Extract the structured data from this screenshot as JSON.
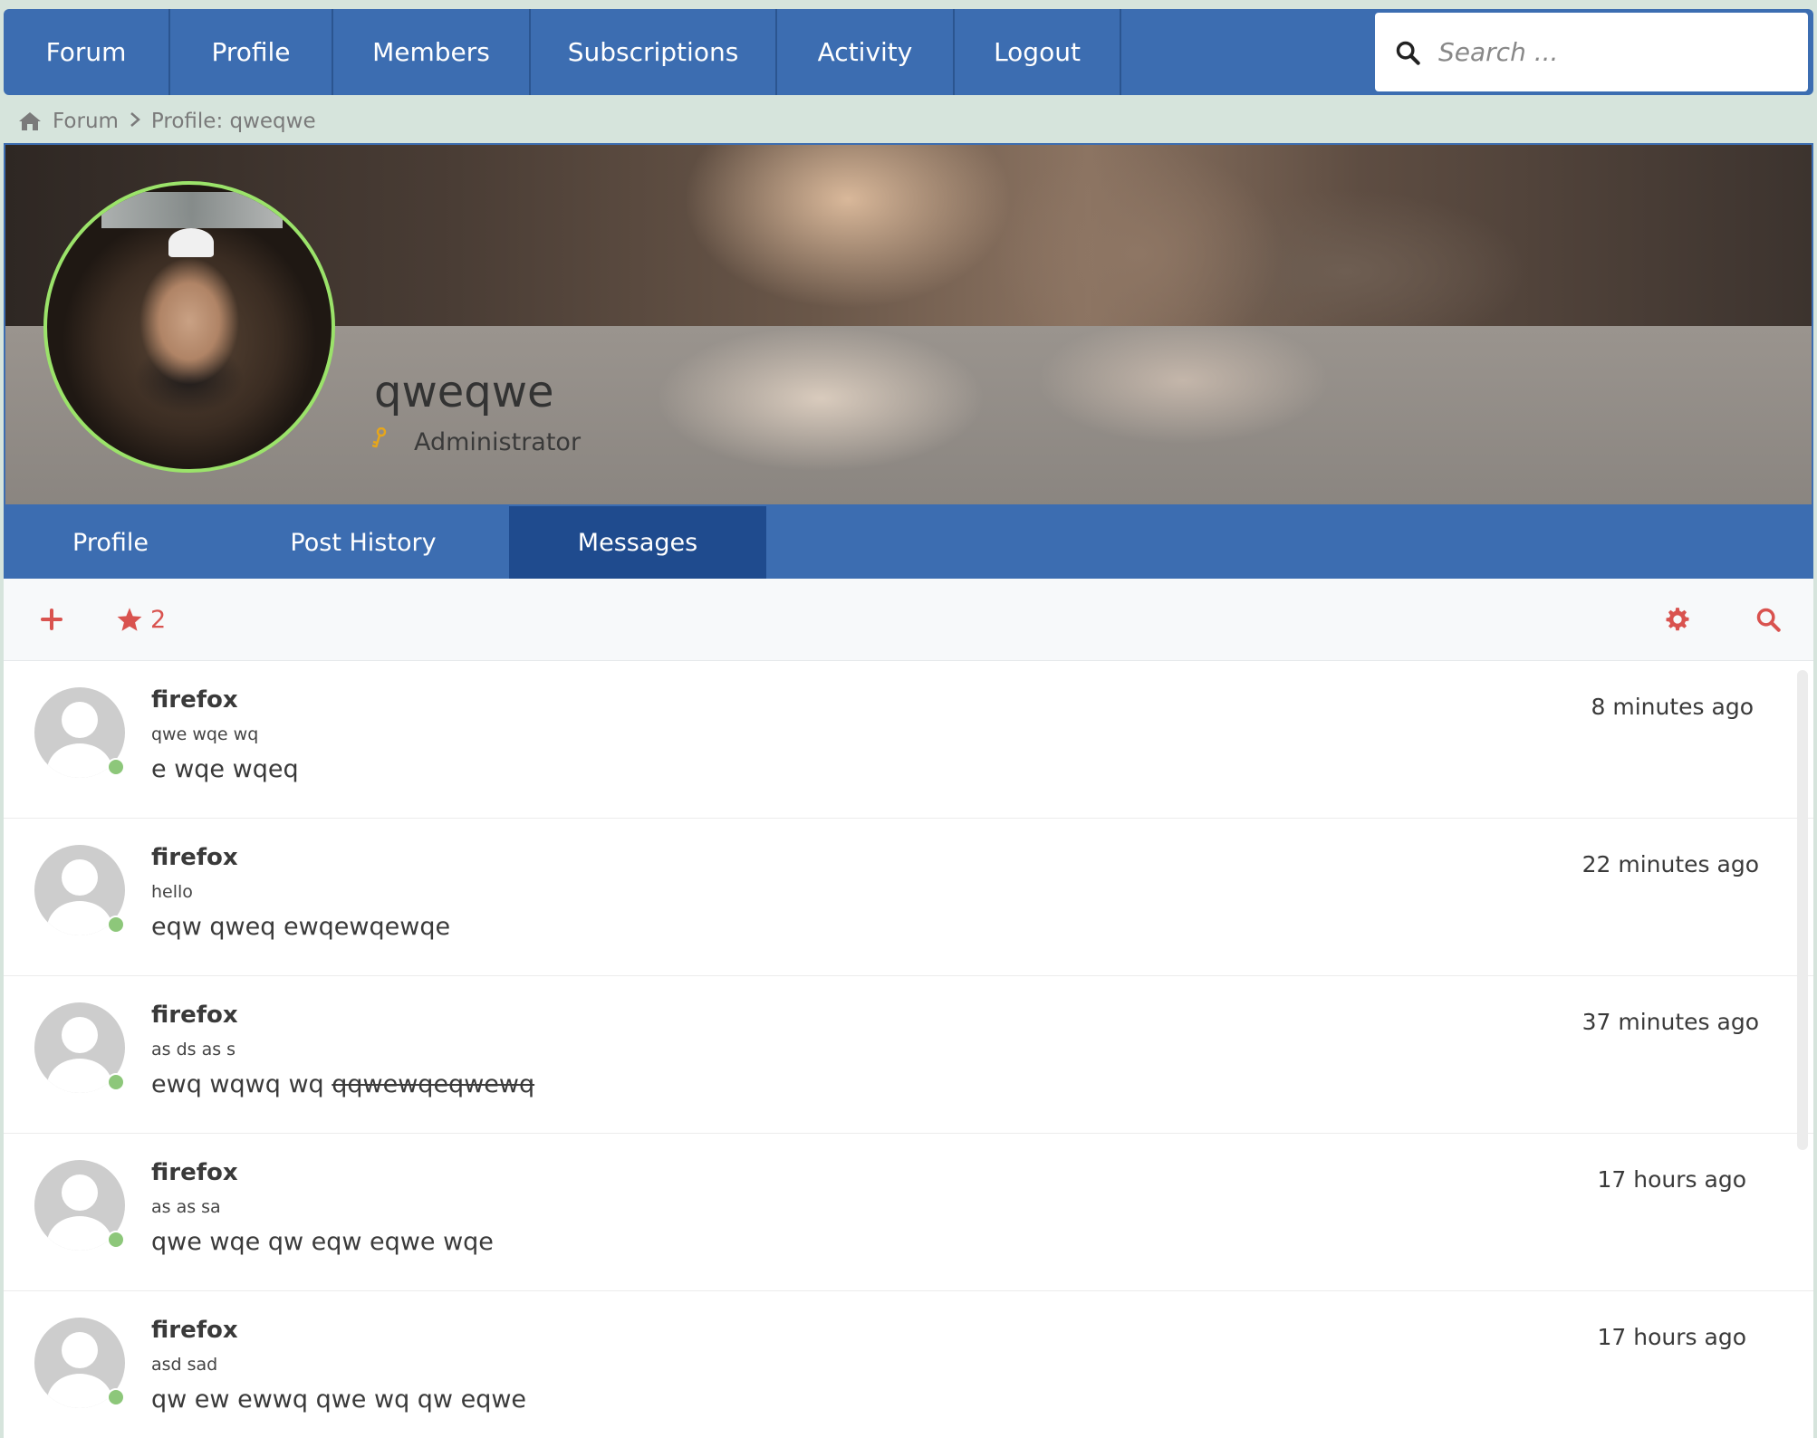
{
  "nav": {
    "items": [
      "Forum",
      "Profile",
      "Members",
      "Subscriptions",
      "Activity",
      "Logout"
    ],
    "search_placeholder": "Search ..."
  },
  "breadcrumb": {
    "home": "Forum",
    "current": "Profile: qweqwe"
  },
  "profile": {
    "username": "qweqwe",
    "role": "Administrator"
  },
  "tabs": [
    {
      "label": "Profile",
      "active": false
    },
    {
      "label": "Post History",
      "active": false
    },
    {
      "label": "Messages",
      "active": true
    }
  ],
  "toolbar": {
    "favorites_count": "2"
  },
  "messages": [
    {
      "author": "firefox",
      "subject": "qwe wqe wq",
      "body": "e wqe wqeq",
      "body_strike": "",
      "time": "8 minutes ago"
    },
    {
      "author": "firefox",
      "subject": "hello",
      "body": "eqw qweq ewqewqewqe",
      "body_strike": "",
      "time": "22 minutes ago"
    },
    {
      "author": "firefox",
      "subject": "as ds as s",
      "body": "ewq wqwq wq ",
      "body_strike": "qqwewqeqwewq",
      "time": "37 minutes ago"
    },
    {
      "author": "firefox",
      "subject": "as as sa",
      "body": "qwe wqe qw eqw eqwe wqe",
      "body_strike": "",
      "time": "17 hours ago"
    },
    {
      "author": "firefox",
      "subject": "asd sad",
      "body": "qw ew ewwq qwe wq qw eqwe",
      "body_strike": "",
      "time": "17 hours ago"
    }
  ],
  "colors": {
    "primary": "#3c6db1",
    "primary_dark": "#1f4b8e",
    "accent": "#d9534f",
    "online": "#8dc77a",
    "background": "#d6e4dc"
  }
}
